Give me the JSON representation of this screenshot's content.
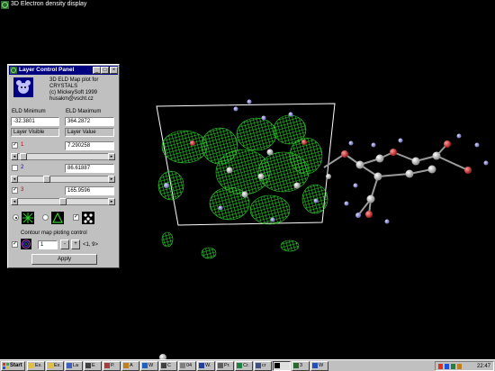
{
  "window": {
    "title": "3D Electron density display"
  },
  "panel": {
    "title": "Layer Control Panel",
    "buttons": [
      "_",
      "□",
      "×"
    ],
    "about_lines": [
      "3D ELD Map plot for",
      "CRYSTALS",
      "(c) MickeySoft 1999",
      "husakm@vscht.cz"
    ],
    "eld_min_label": "ELD Minimum",
    "eld_max_label": "ELD Maximum",
    "eld_min_value": "-32.3801",
    "eld_max_value": "364.2872",
    "layer_visible_label": "Layer Visible",
    "layer_value_label": "Layer Value",
    "layers": [
      {
        "num": "1",
        "checked": "✓",
        "value": "7.290258",
        "color": "#c00000",
        "slider_fraction": 0.02
      },
      {
        "num": "2",
        "checked": "",
        "value": "86.61887",
        "color": "#0000c0",
        "slider_fraction": 0.3
      },
      {
        "num": "3",
        "checked": "✓",
        "value": "165.9596",
        "color": "#c00000",
        "slider_fraction": 0.5
      }
    ],
    "contour_label": "Contour map ploting control",
    "contour_spin_value": "1",
    "contour_range": "<1, 9>",
    "spin_minus": "-",
    "spin_plus": "+",
    "apply_label": "Apply"
  },
  "taskbar": {
    "start_label": "Start",
    "items": [
      "Ex.",
      "Ex.",
      "La",
      "E",
      "P.",
      "A",
      "W",
      "C",
      "04",
      "W.",
      "Pr.",
      "Cr.",
      "cr",
      "",
      "3",
      "W"
    ],
    "clock": "22:47"
  }
}
